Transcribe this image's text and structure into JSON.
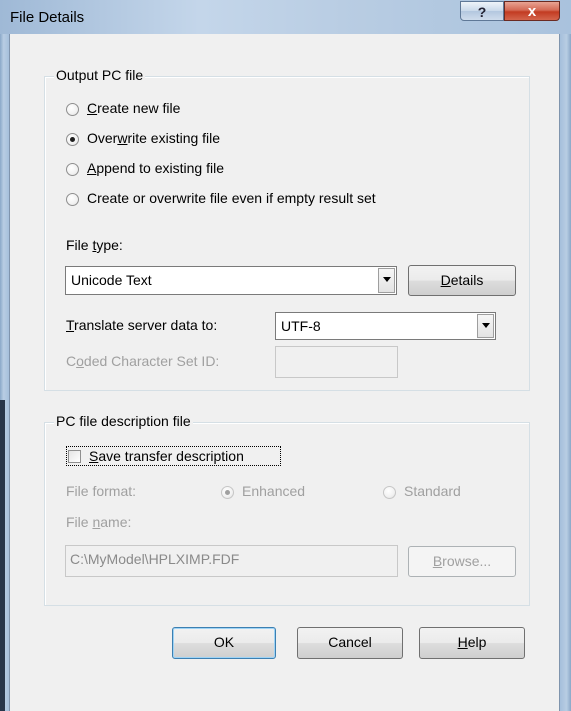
{
  "window": {
    "title": "File Details",
    "help_glyph": "?",
    "close_glyph": "x"
  },
  "output_group": {
    "legend": "Output PC file",
    "options": [
      {
        "pre": "",
        "key": "C",
        "post": "reate new file",
        "selected": false
      },
      {
        "pre": "Over",
        "key": "w",
        "post": "rite existing file",
        "selected": true
      },
      {
        "pre": "",
        "key": "A",
        "post": "ppend to existing file",
        "selected": false
      },
      {
        "pre": "Create or overwrite file even if empty result set",
        "key": "",
        "post": "",
        "selected": false
      }
    ],
    "file_type_label_pre": "File ",
    "file_type_label_key": "t",
    "file_type_label_post": "ype:",
    "file_type_value": "Unicode Text",
    "details_key": "D",
    "details_post": "etails",
    "translate_label_key": "T",
    "translate_label_post": "ranslate server data to:",
    "translate_value": "UTF-8",
    "ccsid_label_pre": "C",
    "ccsid_label_key": "o",
    "ccsid_label_post": "ded Character Set ID:",
    "ccsid_value": ""
  },
  "description_group": {
    "legend": "PC file description file",
    "save_key": "S",
    "save_post": "ave transfer description",
    "save_checked": false,
    "file_format_label": "File format:",
    "format_enhanced": "Enhanced",
    "format_standard": "Standard",
    "file_name_label_pre": "File ",
    "file_name_label_key": "n",
    "file_name_label_post": "ame:",
    "file_name_value": "C:\\MyModel\\HPLXIMP.FDF",
    "browse_key": "B",
    "browse_post": "rowse..."
  },
  "buttons": {
    "ok": "OK",
    "cancel": "Cancel",
    "help_key": "H",
    "help_post": "elp"
  }
}
